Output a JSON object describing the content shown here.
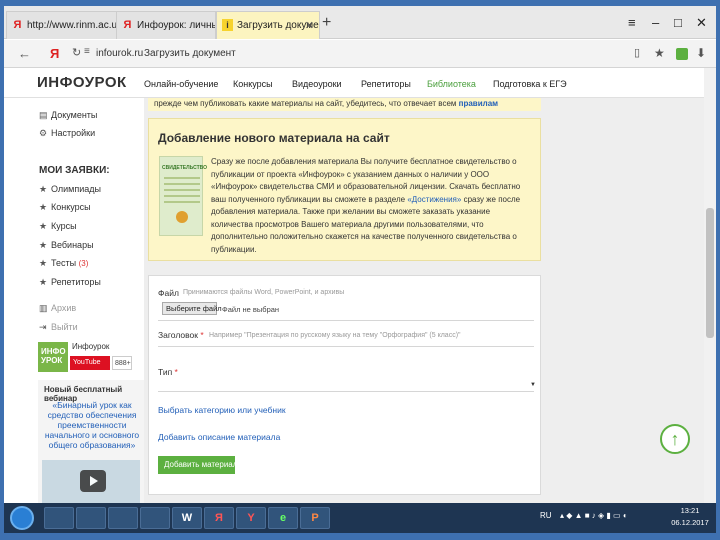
{
  "browser": {
    "tabs": [
      {
        "label": "http://www.rinm.ac.uk/inter",
        "favicon": "Я"
      },
      {
        "label": "Инфоурок: личный кабинет",
        "favicon": "Я"
      },
      {
        "label": "Загрузить документ",
        "favicon": "i"
      }
    ],
    "address": {
      "host": "infourok.ru",
      "title": "Загрузить документ",
      "back_glyph": "Я"
    }
  },
  "site": {
    "logo": "ИНФОУРОК",
    "nav": [
      "Онлайн-обучение",
      "Конкурсы",
      "Видеоуроки",
      "Репетиторы",
      "Библиотека",
      "Подготовка к ЕГЭ"
    ]
  },
  "sidebar": {
    "top_items": [
      "Документы",
      "Настройки"
    ],
    "heading": "МОИ ЗАЯВКИ:",
    "items": [
      "Олимпиады",
      "Конкурсы",
      "Курсы",
      "Вебинары",
      "Тесты",
      "Репетиторы"
    ],
    "tests_count": "(3)",
    "muted_items": [
      "Архив",
      "Выйти"
    ],
    "brand_tile": "ИНФО УРОК",
    "brand_label": "Инфоурок",
    "youtube_label": "YouTube",
    "youtube_count": "888+",
    "webinar_heading": "Новый бесплатный вебинар",
    "webinar_title": "«Бинарный урок как средство обеспечения преемственности начального и основного общего образования»"
  },
  "notice": {
    "text": "прежде чем публиковать какие материалы на сайт, убедитесь, что отвечает всем ",
    "link": "правилам"
  },
  "card": {
    "title": "Добавление нового материала на сайт",
    "cert_text": "СВИДЕТЕЛЬСТВО",
    "text_before": "Сразу же после добавления материала Вы получите бесплатное свидетельство о публикации от проекта «Инфоурок» с указанием данных о наличии у ООО «Инфоурок» свидетельства СМИ и образовательной лицензии. Скачать бесплатно ваш полученного публикации вы сможете в разделе ",
    "link": "«Достижения»",
    "text_after": " сразу же после добавления материала. Также при желании вы сможете заказать указание количества просмотров Вашего материала другими пользователями, что дополнительно положительно скажется на качестве полученного свидетельства о публикации."
  },
  "form": {
    "file_label": "Файл",
    "file_hint": "Принимаются файлы Word, PowerPoint, и архивы",
    "file_button": "Выберите файл",
    "file_status": "Файл не выбран",
    "title_label": "Заголовок",
    "title_placeholder": "Например \"Презентация по русскому языку на тему \"Орфография\" (5 класс)\"",
    "type_label": "Тип",
    "choose_category": "Выбрать категорию или учебник",
    "add_description": "Добавить описание материала",
    "submit": "Добавить материал"
  },
  "taskbar": {
    "apps": [
      "",
      "",
      "",
      "",
      "W",
      "Я",
      "Y",
      "e",
      "P"
    ],
    "lang": "RU",
    "time": "13:21",
    "date": "06.12.2017"
  }
}
